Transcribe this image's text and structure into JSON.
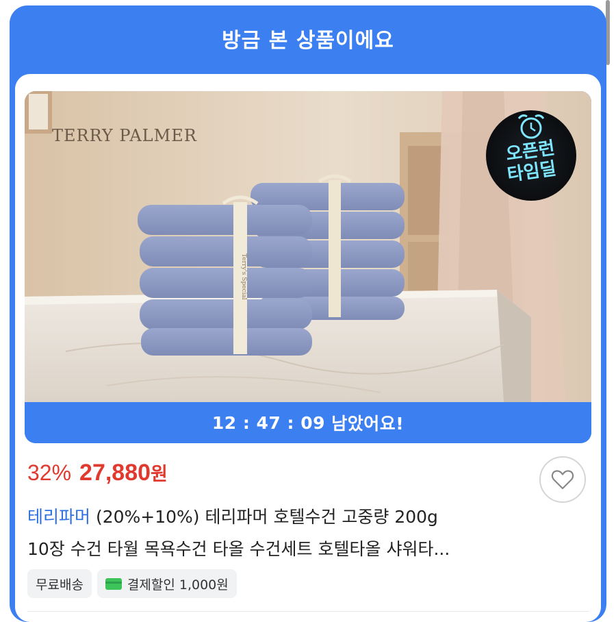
{
  "header": {
    "title": "방금 본 상품이에요"
  },
  "product": {
    "image_brand_text": "TERRY PALMER",
    "badge": {
      "line1": "오픈런",
      "line2": "타임딜",
      "icon": "alarm-clock-icon"
    },
    "band_label": "Terry's Special",
    "timer": {
      "time": "12 : 47 : 09",
      "suffix": " 남았어요!"
    },
    "discount": "32%",
    "price": "27,880",
    "currency": "원",
    "brand": "테리파머",
    "title_line1_rest": " (20%+10%) 테리파머 호텔수건 고중량 200g",
    "title_line2": "10장 수건 타월 목욕수건 타올 수건세트 호텔타올 샤워타...",
    "tags": {
      "free_shipping": "무료배송",
      "payment_discount": "결제할인 1,000원"
    },
    "wishlist_icon": "heart-icon"
  },
  "colors": {
    "accent": "#3b7ff0",
    "price": "#e03a2f",
    "brand": "#2e6fe0",
    "badge_text": "#7ee6ff"
  }
}
